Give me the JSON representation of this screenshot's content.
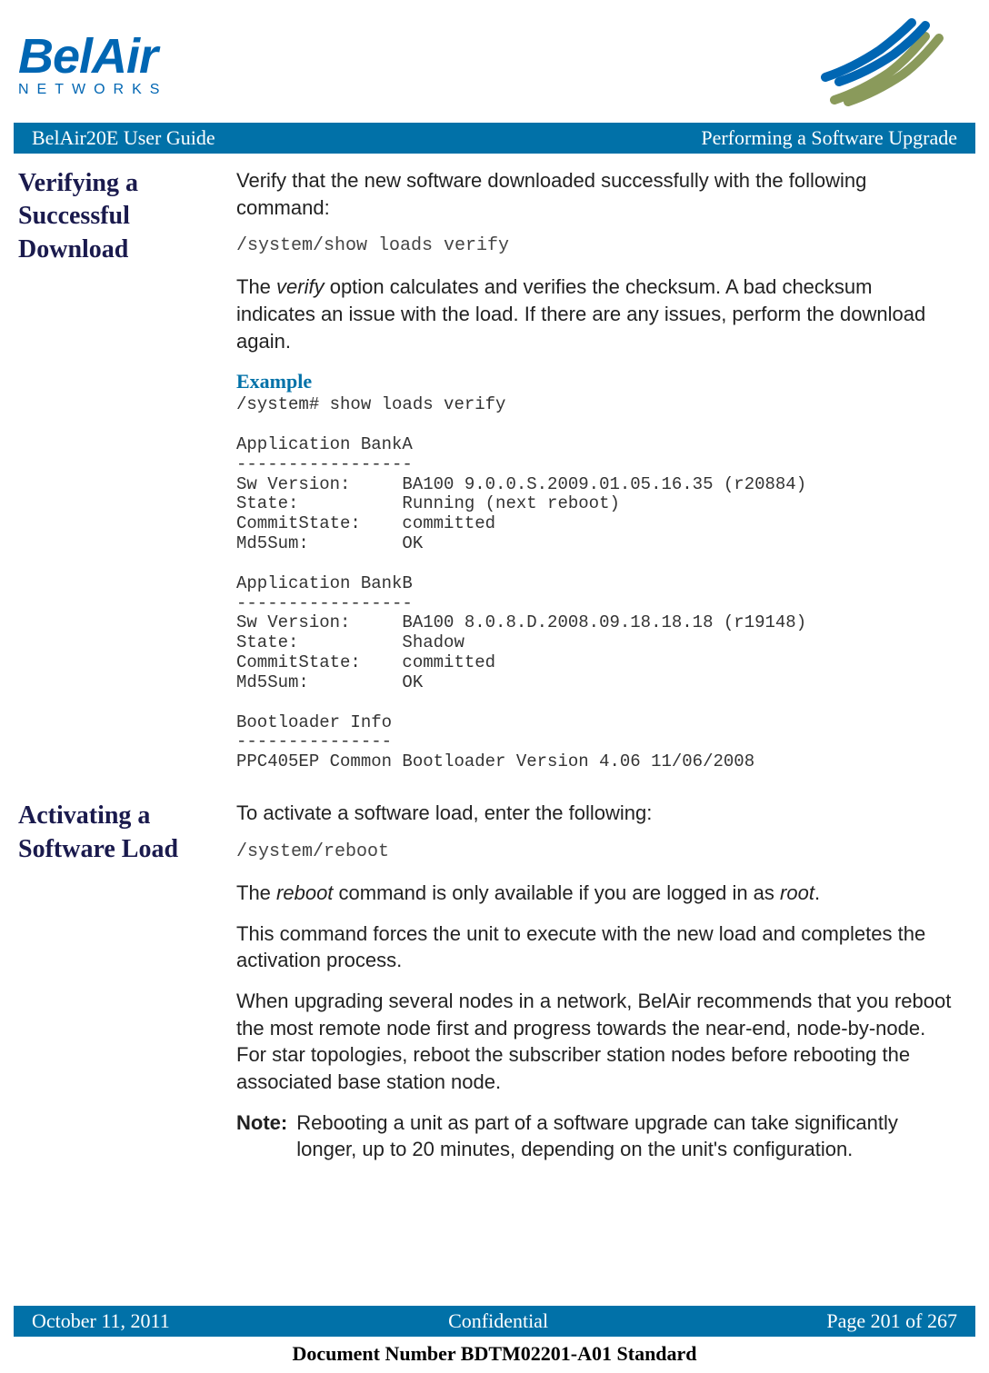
{
  "header": {
    "logo_main": "BelAir",
    "logo_sub": "NETWORKS"
  },
  "banner": {
    "left": "BelAir20E User Guide",
    "right": "Performing a Software Upgrade"
  },
  "section1": {
    "title": "Verifying a Successful Download",
    "para1": "Verify that the new software downloaded successfully with the following command:",
    "cmd1": "/system/show loads verify",
    "para2_a": "The ",
    "para2_b": "verify",
    "para2_c": " option calculates and verifies the checksum. A bad checksum indicates an issue with the load. If there are any issues, perform the download again.",
    "example_label": "Example",
    "example_block": "/system# show loads verify\n\nApplication BankA\n-----------------\nSw Version:     BA100 9.0.0.S.2009.01.05.16.35 (r20884)\nState:          Running (next reboot)\nCommitState:    committed\nMd5Sum:         OK\n\nApplication BankB\n-----------------\nSw Version:     BA100 8.0.8.D.2008.09.18.18.18 (r19148)\nState:          Shadow\nCommitState:    committed\nMd5Sum:         OK\n\nBootloader Info\n---------------\nPPC405EP Common Bootloader Version 4.06 11/06/2008"
  },
  "section2": {
    "title": "Activating a Software Load",
    "para1": "To activate a software load, enter the following:",
    "cmd1": "/system/reboot",
    "para2_a": "The ",
    "para2_b": "reboot",
    "para2_c": " command is only available if you are logged in as ",
    "para2_d": "root",
    "para2_e": ".",
    "para3": "This command forces the unit to execute with the new load and completes the activation process.",
    "para4": "When upgrading several nodes in a network, BelAir recommends that you reboot the most remote node first and progress towards the near-end, node-by-node. For star topologies, reboot the subscriber station nodes before rebooting the associated base station node.",
    "note_label": "Note:",
    "note_text": "Rebooting a unit as part of a software upgrade can take significantly longer, up to 20 minutes, depending on the unit's configuration."
  },
  "footer": {
    "left": "October 11, 2011",
    "center": "Confidential",
    "right": "Page 201 of 267",
    "doc_number": "Document Number BDTM02201-A01 Standard"
  }
}
